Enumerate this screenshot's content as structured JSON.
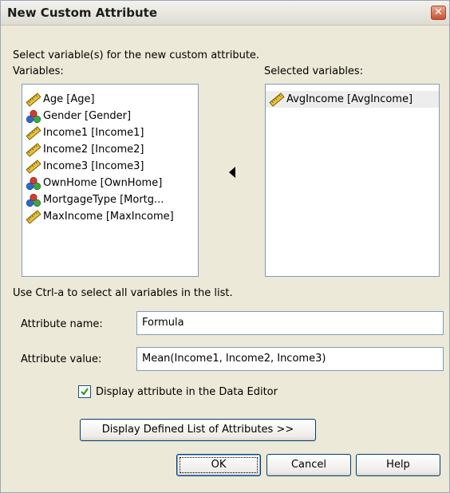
{
  "window": {
    "title": "New Custom Attribute",
    "close_glyph": "✕"
  },
  "instructions": {
    "select_prompt": "Select variable(s) for the new custom attribute.",
    "variables_label": "Variables:",
    "selected_label": "Selected variables:",
    "ctrl_hint": "Use Ctrl-a to select all variables in the list."
  },
  "variables": [
    {
      "label": "Age [Age]",
      "icon": "ruler-icon"
    },
    {
      "label": "Gender [Gender]",
      "icon": "nominal-icon"
    },
    {
      "label": "Income1 [Income1]",
      "icon": "ruler-icon"
    },
    {
      "label": "Income2 [Income2]",
      "icon": "ruler-icon"
    },
    {
      "label": "Income3 [Income3]",
      "icon": "ruler-icon"
    },
    {
      "label": "OwnHome [OwnHome]",
      "icon": "nominal-icon"
    },
    {
      "label": "MortgageType [Mortg...",
      "icon": "nominal-icon"
    },
    {
      "label": "MaxIncome [MaxIncome]",
      "icon": "ruler-icon"
    }
  ],
  "selected_variables": [
    {
      "label": "AvgIncome [AvgIncome]",
      "icon": "ruler-icon"
    }
  ],
  "move_arrow": "◀",
  "attribute": {
    "name_label": "Attribute name:",
    "name_value": "Formula",
    "value_label": "Attribute value:",
    "value_value": "Mean(Income1, Income2, Income3)"
  },
  "display_checkbox": {
    "label": "Display attribute in the Data Editor",
    "checked": true
  },
  "buttons": {
    "display_list": "Display Defined List of Attributes >>",
    "ok": "OK",
    "cancel": "Cancel",
    "help": "Help"
  }
}
